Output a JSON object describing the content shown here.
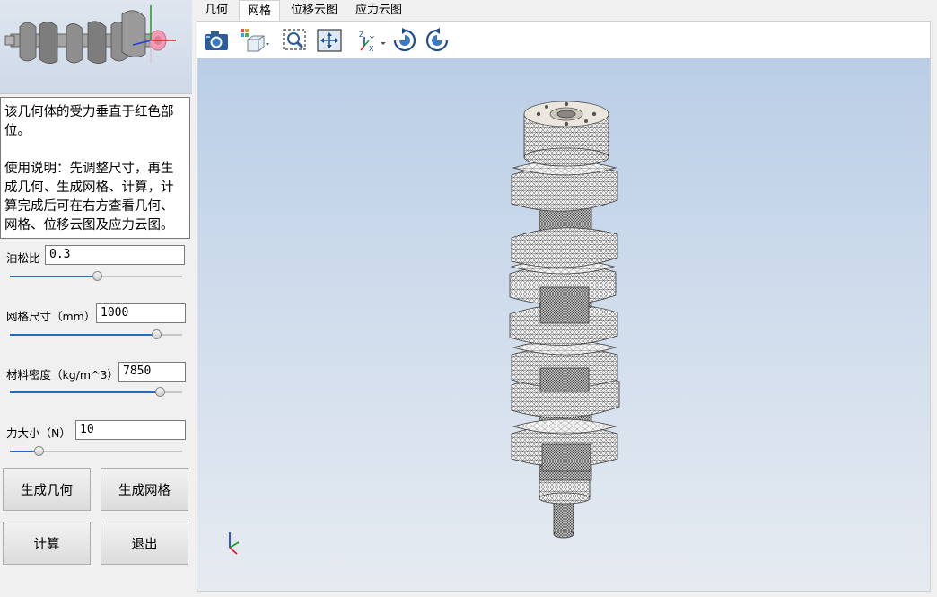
{
  "description": {
    "line1": "该几何体的受力垂直于红色部位。",
    "line2": "使用说明：先调整尺寸，再生成几何、生成网格、计算，计算完成后可在右方查看几何、网格、位移云图及应力云图。"
  },
  "params": [
    {
      "label": "泊松比",
      "value": "0.3",
      "slider_fraction": 0.51
    },
    {
      "label": "网格尺寸（mm）",
      "value": "1000",
      "slider_fraction": 0.85
    },
    {
      "label": "材料密度（kg/m^3）",
      "value": "7850",
      "slider_fraction": 0.87
    },
    {
      "label": "力大小（N）",
      "value": "10",
      "slider_fraction": 0.17
    }
  ],
  "buttons": {
    "gen_geometry": "生成几何",
    "gen_mesh": "生成网格",
    "compute": "计算",
    "exit": "退出"
  },
  "tabs": [
    "几何",
    "网格",
    "位移云图",
    "应力云图"
  ],
  "active_tab": "网格",
  "toolbar_icons": [
    "camera-icon",
    "view-cube-icon",
    "zoom-fit-icon",
    "pan-icon",
    "axis-view-icon",
    "rotate-cw-icon",
    "rotate-ccw-icon"
  ],
  "colors": {
    "accent": "#1e6ec6",
    "highlight_face": "#f29bb2",
    "axis_x": "#e02020",
    "axis_y": "#20a020",
    "axis_z": "#2040d0"
  }
}
